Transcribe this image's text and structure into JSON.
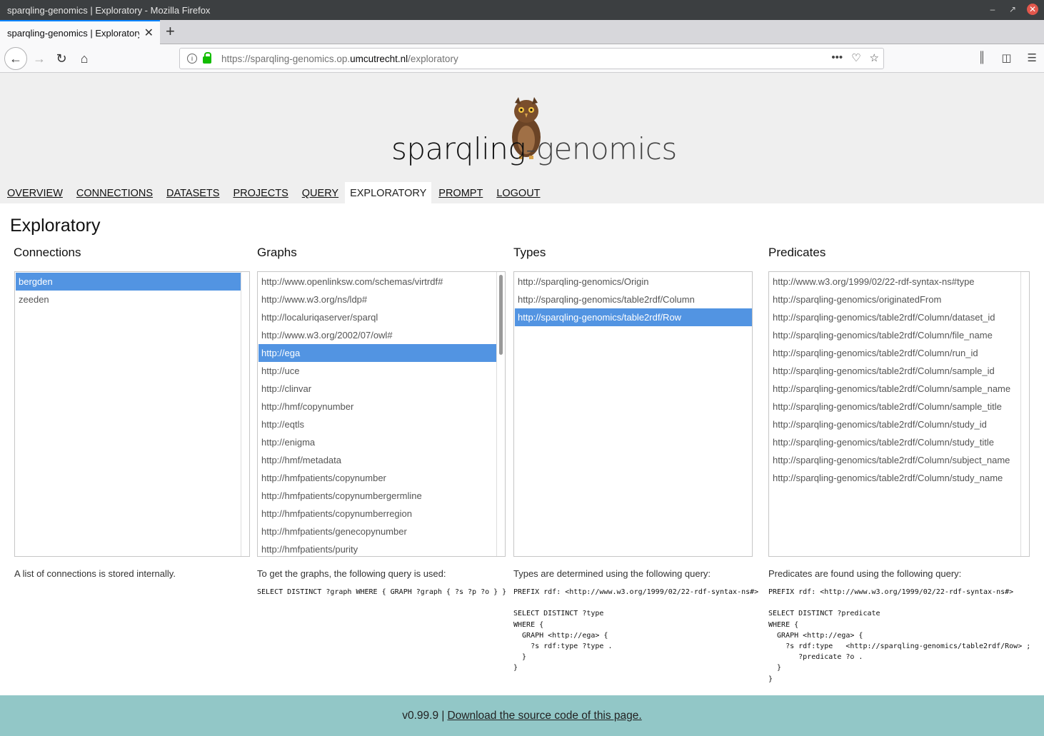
{
  "window": {
    "title": "sparqling-genomics | Exploratory - Mozilla Firefox"
  },
  "tab": {
    "title": "sparqling-genomics | Exploratory"
  },
  "urlbar": {
    "prefix": "https://sparqling-genomics.op.",
    "domain": "umcutrecht.nl",
    "path": "/exploratory"
  },
  "logo": {
    "main": "sparqling",
    "light": "-genomics"
  },
  "menu": [
    "OVERVIEW",
    "CONNECTIONS",
    "DATASETS",
    "PROJECTS",
    "QUERY",
    "EXPLORATORY",
    "PROMPT",
    "LOGOUT"
  ],
  "page_title": "Exploratory",
  "connections": {
    "heading": "Connections",
    "items": [
      "bergden",
      "zeeden"
    ],
    "description": "A list of connections is stored internally."
  },
  "graphs": {
    "heading": "Graphs",
    "items": [
      "http://www.openlinksw.com/schemas/virtrdf#",
      "http://www.w3.org/ns/ldp#",
      "http://localuriqaserver/sparql",
      "http://www.w3.org/2002/07/owl#",
      "http://ega",
      "http://uce",
      "http://clinvar",
      "http://hmf/copynumber",
      "http://eqtls",
      "http://enigma",
      "http://hmf/metadata",
      "http://hmfpatients/copynumber",
      "http://hmfpatients/copynumbergermline",
      "http://hmfpatients/copynumberregion",
      "http://hmfpatients/genecopynumber",
      "http://hmfpatients/purity"
    ],
    "description": "To get the graphs, the following query is used:",
    "query": "SELECT DISTINCT ?graph WHERE { GRAPH ?graph { ?s ?p ?o } }"
  },
  "types": {
    "heading": "Types",
    "items": [
      "http://sparqling-genomics/Origin",
      "http://sparqling-genomics/table2rdf/Column",
      "http://sparqling-genomics/table2rdf/Row"
    ],
    "description": "Types are determined using the following query:",
    "query": "PREFIX rdf: <http://www.w3.org/1999/02/22-rdf-syntax-ns#>\n\nSELECT DISTINCT ?type\nWHERE {\n  GRAPH <http://ega> {\n    ?s rdf:type ?type .\n  }\n}"
  },
  "predicates": {
    "heading": "Predicates",
    "items": [
      "http://www.w3.org/1999/02/22-rdf-syntax-ns#type",
      "http://sparqling-genomics/originatedFrom",
      "http://sparqling-genomics/table2rdf/Column/dataset_id",
      "http://sparqling-genomics/table2rdf/Column/file_name",
      "http://sparqling-genomics/table2rdf/Column/run_id",
      "http://sparqling-genomics/table2rdf/Column/sample_id",
      "http://sparqling-genomics/table2rdf/Column/sample_name",
      "http://sparqling-genomics/table2rdf/Column/sample_title",
      "http://sparqling-genomics/table2rdf/Column/study_id",
      "http://sparqling-genomics/table2rdf/Column/study_title",
      "http://sparqling-genomics/table2rdf/Column/subject_name",
      "http://sparqling-genomics/table2rdf/Column/study_name"
    ],
    "description": "Predicates are found using the following query:",
    "query": "PREFIX rdf: <http://www.w3.org/1999/02/22-rdf-syntax-ns#>\n\nSELECT DISTINCT ?predicate\nWHERE {\n  GRAPH <http://ega> {\n    ?s rdf:type   <http://sparqling-genomics/table2rdf/Row> ;\n       ?predicate ?o .\n  }\n}"
  },
  "footer": {
    "version": "v0.99.9 |",
    "link": "Download the source code of this page."
  }
}
